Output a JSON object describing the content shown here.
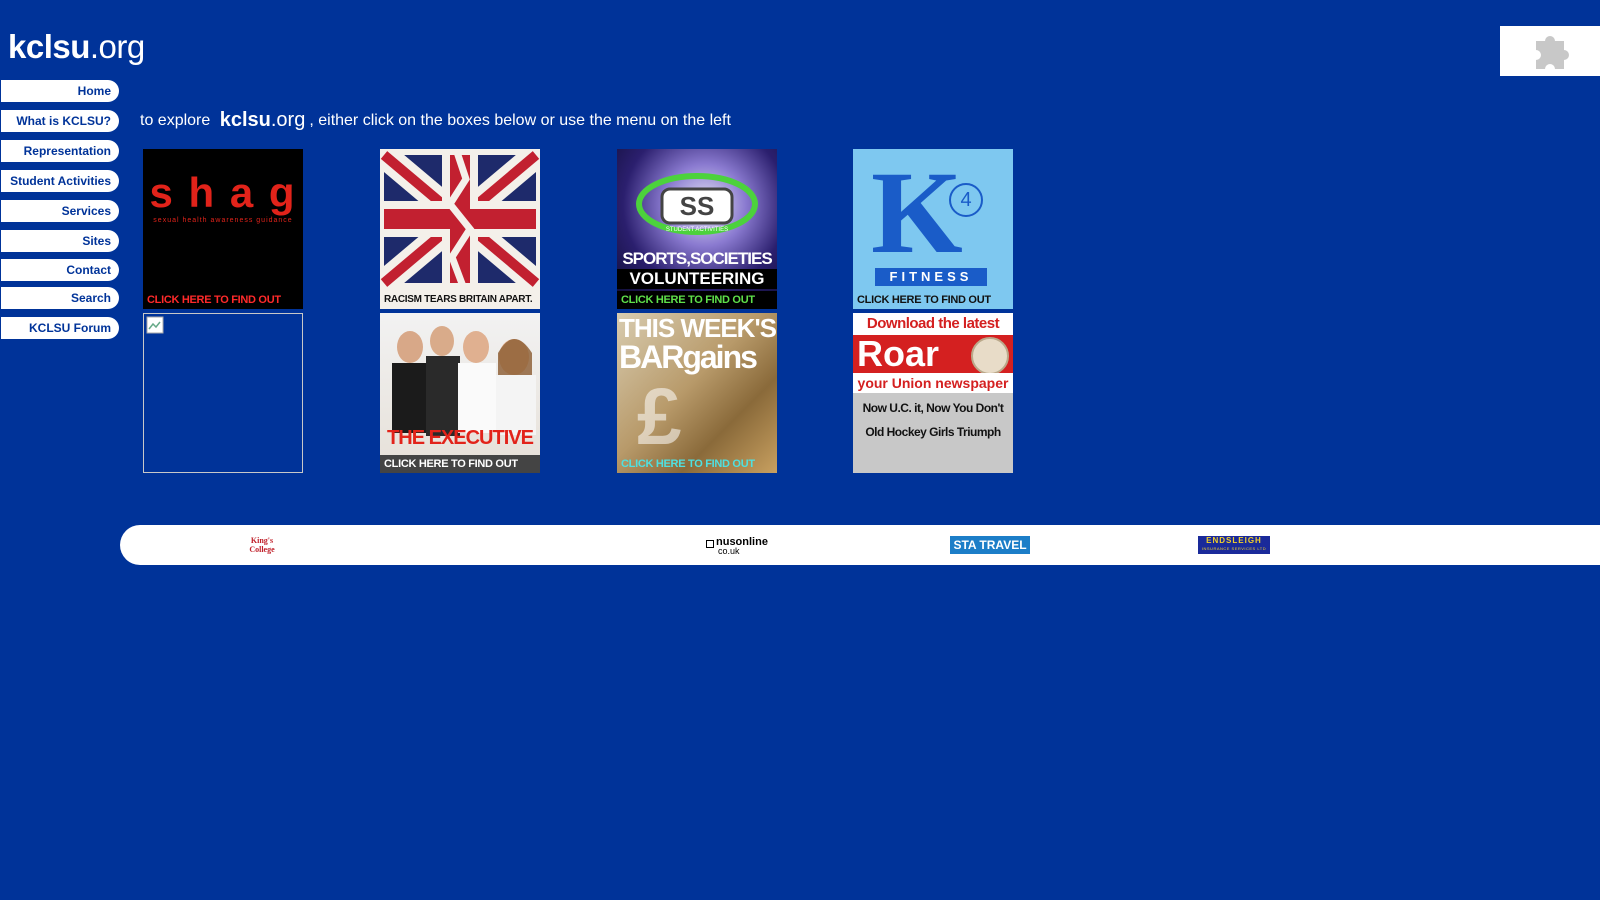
{
  "header": {
    "logo_bold": "kclsu",
    "logo_rest": ".org"
  },
  "menu": {
    "items": [
      {
        "label": "Home"
      },
      {
        "label": "What is KCLSU?"
      },
      {
        "label": "Representation"
      },
      {
        "label": "Student Activities"
      },
      {
        "label": "Services"
      },
      {
        "label": "Sites"
      },
      {
        "label": "Contact"
      },
      {
        "label": "Search"
      },
      {
        "label": "KCLSU Forum"
      }
    ]
  },
  "intro": {
    "prefix": "to explore",
    "brand_bold": "kclsu",
    "brand_rest": ".org",
    "suffix": ", either click on the boxes below or use the menu on the left"
  },
  "tiles": {
    "shag": {
      "title": "s h a g",
      "subtitle": "sexual health awareness guidance",
      "cta": "CLICK HERE TO FIND OUT MORE"
    },
    "racism": {
      "caption": "RACISM TEARS BRITAIN APART."
    },
    "sports": {
      "badge": "STUDENT ACTIVITIES",
      "line1": "SPORTS,SOCIETIES",
      "line2": "VOLUNTEERING",
      "cta": "CLICK HERE TO FIND OUT MORE"
    },
    "fitness": {
      "letter": "K",
      "number": "4",
      "word": "FITNESS",
      "cta": "CLICK HERE TO FIND OUT MORE"
    },
    "executive": {
      "title": "THE EXECUTIVE",
      "cta": "CLICK HERE TO FIND OUT MORE"
    },
    "bargains": {
      "line1": "THIS WEEK'S",
      "line2": "BARgains",
      "symbol": "£",
      "cta": "CLICK HERE TO FIND OUT MORE"
    },
    "roar": {
      "top": "Download the latest",
      "name": "Roar",
      "sub": "your Union newspaper",
      "headline1": "Now U.C. it, Now You Don't",
      "headline2": "Old Hockey Girls Triumph"
    }
  },
  "sponsors": {
    "kings": "King's College",
    "nus_top": "nusonline",
    "nus_bottom": "co.uk",
    "sta": "STA TRAVEL",
    "endsleigh": "ENDSLEIGH",
    "endsleigh_sub": "INSURANCE SERVICES LTD"
  }
}
